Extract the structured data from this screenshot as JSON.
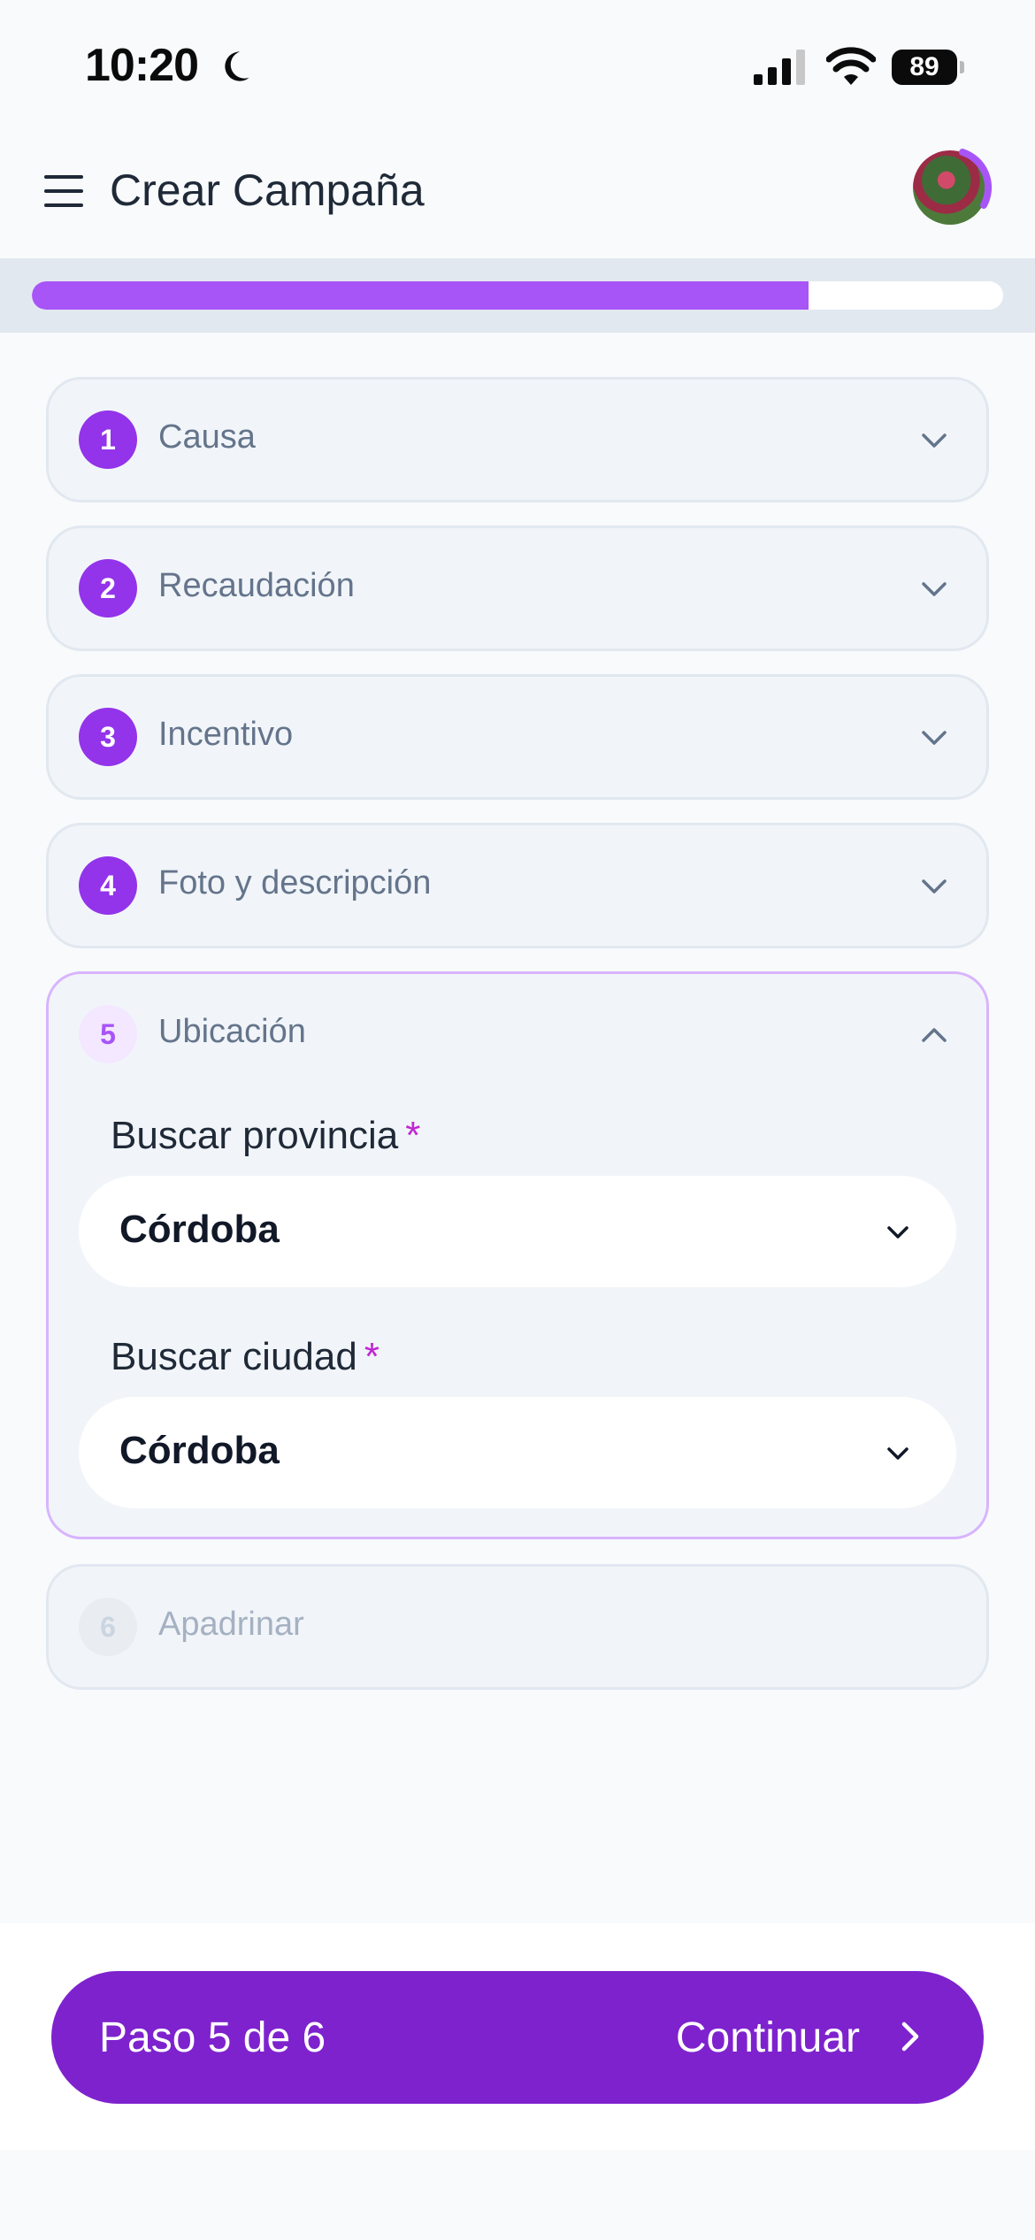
{
  "status_bar": {
    "time": "10:20",
    "battery": "89"
  },
  "header": {
    "title": "Crear Campaña"
  },
  "progress": {
    "fraction": 0.8
  },
  "steps": [
    {
      "number": "1",
      "label": "Causa"
    },
    {
      "number": "2",
      "label": "Recaudación"
    },
    {
      "number": "3",
      "label": "Incentivo"
    },
    {
      "number": "4",
      "label": "Foto y descripción"
    },
    {
      "number": "5",
      "label": "Ubicación"
    },
    {
      "number": "6",
      "label": "Apadrinar"
    }
  ],
  "location": {
    "province_label": "Buscar provincia",
    "province_value": "Córdoba",
    "city_label": "Buscar ciudad",
    "city_value": "Córdoba",
    "required_mark": "*"
  },
  "footer": {
    "step_text": "Paso 5 de 6",
    "continue_label": "Continuar"
  },
  "colors": {
    "accent": "#9333ea",
    "cta": "#7e22ce",
    "progress": "#a855f7"
  }
}
